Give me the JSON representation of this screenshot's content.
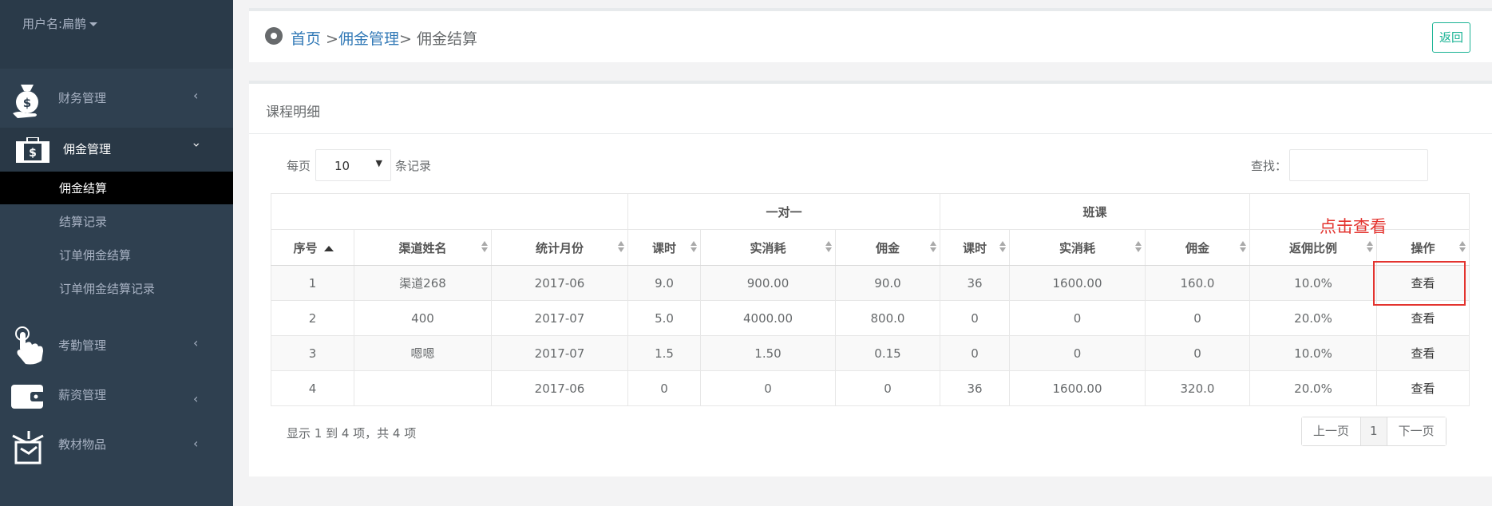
{
  "sidebar": {
    "logo_text": "",
    "username": "用户名:扁鹊",
    "menus": [
      {
        "label": "财务管理",
        "icon": "money-bag-icon"
      },
      {
        "label": "佣金管理",
        "icon": "briefcase-dollar-icon"
      },
      {
        "label": "考勤管理",
        "icon": "hand-pointer-icon"
      },
      {
        "label": "薪资管理",
        "icon": "wallet-icon"
      },
      {
        "label": "教材物品",
        "icon": "box-icon"
      }
    ],
    "submenu": [
      "佣金结算",
      "结算记录",
      "订单佣金结算",
      "订单佣金结算记录"
    ]
  },
  "breadcrumb": {
    "home": "首页",
    "sep1": " >",
    "parent": "佣金管理",
    "sep2": "> ",
    "current": "佣金结算",
    "back_label": "返回"
  },
  "panel": {
    "title": "课程明细",
    "length_prefix": "每页",
    "length_value": "10",
    "length_suffix": "条记录",
    "search_label": "查找："
  },
  "table": {
    "group_headers": [
      "",
      "一对一",
      "班课",
      ""
    ],
    "headers": [
      "序号",
      "渠道姓名",
      "统计月份",
      "课时",
      "实消耗",
      "佣金",
      "课时",
      "实消耗",
      "佣金",
      "返佣比例",
      "操作"
    ],
    "rows": [
      [
        "1",
        "渠道268",
        "2017-06",
        "9.0",
        "900.00",
        "90.0",
        "36",
        "1600.00",
        "160.0",
        "10.0%",
        "查看"
      ],
      [
        "2",
        "400",
        "2017-07",
        "5.0",
        "4000.00",
        "800.0",
        "0",
        "0",
        "0",
        "20.0%",
        "查看"
      ],
      [
        "3",
        "嗯嗯",
        "2017-07",
        "1.5",
        "1.50",
        "0.15",
        "0",
        "0",
        "0",
        "10.0%",
        "查看"
      ],
      [
        "4",
        "",
        "2017-06",
        "0",
        "0",
        "0",
        "36",
        "1600.00",
        "320.0",
        "20.0%",
        "查看"
      ]
    ],
    "info": "显示 1 到 4 项，共 4 项"
  },
  "pagination": {
    "prev": "上一页",
    "current": "1",
    "next": "下一页"
  },
  "annotation": {
    "text": "点击查看",
    "color": "#e3342f"
  },
  "colors": {
    "sidebar": "#2f4050",
    "accent": "#1ab394",
    "link": "#337ab7"
  }
}
